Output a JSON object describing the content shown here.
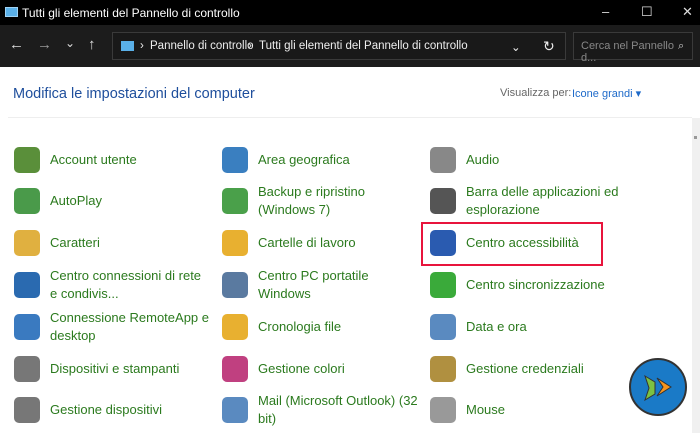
{
  "window": {
    "title": "Tutti gli elementi del Pannello di controllo",
    "minimize": "–",
    "maximize": "☐",
    "close": "✕"
  },
  "nav": {
    "back": "←",
    "forward": "→",
    "recent": "⌄",
    "up": "↑",
    "refresh": "↻",
    "dropdown": "⌄",
    "breadcrumb": [
      "Pannello di controllo",
      "Tutti gli elementi del Pannello di controllo"
    ],
    "search_placeholder": "Cerca nel Pannello d...",
    "search_icon": "⌕"
  },
  "header": {
    "title": "Modifica le impostazioni del computer",
    "view_by_label": "Visualizza per:",
    "view_by_value": "Icone grandi ▾"
  },
  "accent": "#2b7a1e",
  "items": [
    {
      "label": "Account utente",
      "color": "#5a8f3a"
    },
    {
      "label": "Area geografica",
      "color": "#3a7fc0"
    },
    {
      "label": "Audio",
      "color": "#888888"
    },
    {
      "label": "AutoPlay",
      "color": "#4a9a4a"
    },
    {
      "label": "Backup e ripristino (Windows 7)",
      "color": "#4aa04a"
    },
    {
      "label": "Barra delle applicazioni ed esplorazione",
      "color": "#555555"
    },
    {
      "label": "Caratteri",
      "color": "#e0b040"
    },
    {
      "label": "Cartelle di lavoro",
      "color": "#e8b030"
    },
    {
      "label": "Centro accessibilità",
      "color": "#2a5bb0"
    },
    {
      "label": "Centro connessioni di rete e condivis...",
      "color": "#2a6ab0"
    },
    {
      "label": "Centro PC portatile Windows",
      "color": "#5a7aa0"
    },
    {
      "label": "Centro sincronizzazione",
      "color": "#3aaa3a"
    },
    {
      "label": "Connessione RemoteApp e desktop",
      "color": "#3a7ac0"
    },
    {
      "label": "Cronologia file",
      "color": "#e8b030"
    },
    {
      "label": "Data e ora",
      "color": "#5a8ac0"
    },
    {
      "label": "Dispositivi e stampanti",
      "color": "#777777"
    },
    {
      "label": "Gestione colori",
      "color": "#c04080"
    },
    {
      "label": "Gestione credenziali",
      "color": "#b09040"
    },
    {
      "label": "Gestione dispositivi",
      "color": "#777777"
    },
    {
      "label": "Mail (Microsoft Outlook) (32 bit)",
      "color": "#5a8ac0"
    },
    {
      "label": "Mouse",
      "color": "#999999"
    }
  ],
  "highlighted": "Centro accessibilità"
}
